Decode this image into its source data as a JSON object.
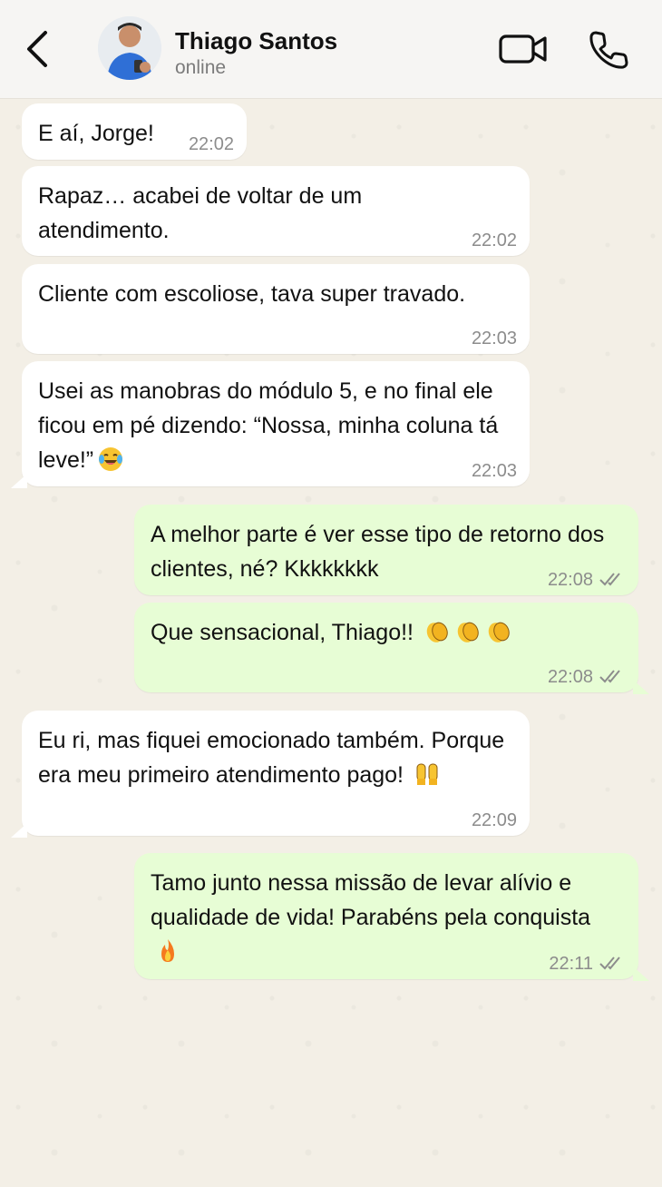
{
  "header": {
    "contact_name": "Thiago Santos",
    "status": "online",
    "icons": {
      "back": "chevron-left-icon",
      "video": "video-camera-icon",
      "call": "phone-icon"
    }
  },
  "messages": [
    {
      "direction": "in",
      "text": "E aí, Jorge!",
      "time": "22:02"
    },
    {
      "direction": "in",
      "text": "Rapaz… acabei de voltar de um atendimento.",
      "time": "22:02"
    },
    {
      "direction": "in",
      "text": "Cliente com escoliose, tava super travado.",
      "time": "22:03"
    },
    {
      "direction": "in",
      "text": "Usei as manobras do módulo 5, e no final ele ficou em pé dizendo: “Nossa, minha coluna tá leve!”",
      "emoji": "laughing-tears-emoji",
      "time": "22:03"
    },
    {
      "direction": "out",
      "text": "A melhor parte é ver esse tipo de retorno dos clientes, né? Kkkkkkkk",
      "time": "22:08",
      "status": "read"
    },
    {
      "direction": "out",
      "text": "Que sensacional, Thiago!!",
      "emoji": "clapping-hands-emoji",
      "time": "22:08",
      "status": "read"
    },
    {
      "direction": "in",
      "text": "Eu ri, mas fiquei emocionado também. Porque era meu primeiro atendimento pago!",
      "emoji": "raising-hands-emoji",
      "time": "22:09"
    },
    {
      "direction": "out",
      "text": "Tamo junto nessa missão de levar alívio e qualidade de vida! Parabéns pela conquista",
      "emoji": "fire-emoji",
      "time": "22:11",
      "status": "read"
    }
  ],
  "colors": {
    "incoming_bubble": "#ffffff",
    "outgoing_bubble": "#e7fdd5",
    "chat_background": "#f3efe6",
    "header_background": "#f6f5f3",
    "read_ticks": "#8c8c8c"
  }
}
